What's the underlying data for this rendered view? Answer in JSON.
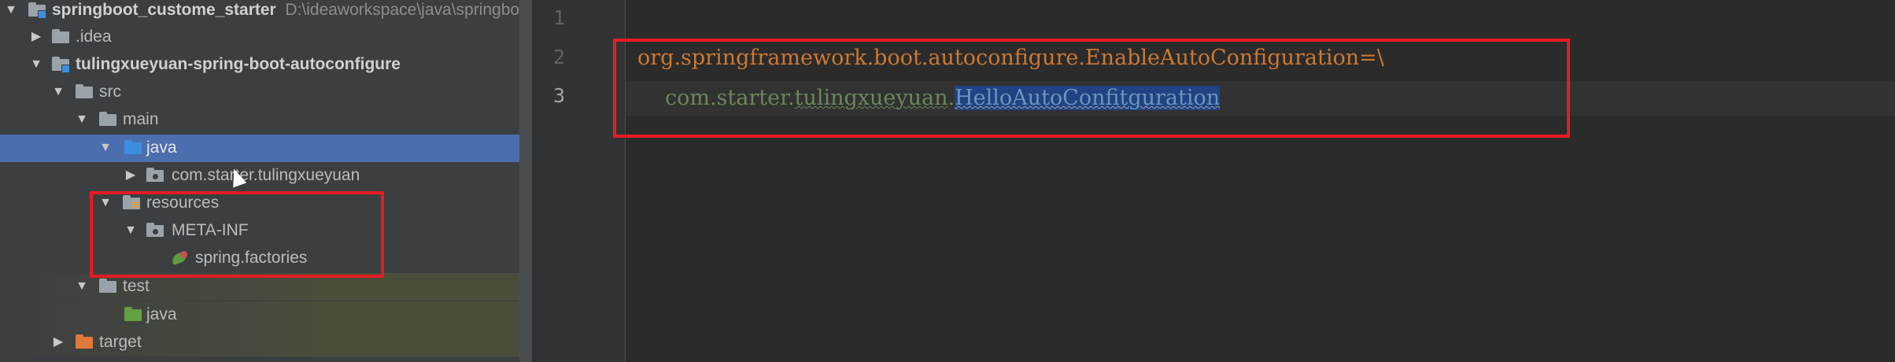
{
  "tree": {
    "rows": [
      {
        "label": "springboot_custome_starter",
        "path": "D:\\ideaworkspace\\java\\springbo"
      },
      {
        "label": ".idea"
      },
      {
        "label": "tulingxueyuan-spring-boot-autoconfigure"
      },
      {
        "label": "src"
      },
      {
        "label": "main"
      },
      {
        "label": "java"
      },
      {
        "label": "com.starter.tulingxueyuan"
      },
      {
        "label": "resources"
      },
      {
        "label": "META-INF"
      },
      {
        "label": "spring.factories"
      },
      {
        "label": "test"
      },
      {
        "label": "java"
      },
      {
        "label": "target"
      }
    ]
  },
  "editor": {
    "line_numbers": [
      "1",
      "2",
      "3"
    ],
    "line2": {
      "package": "org.springframework.boot.autoconfigure.",
      "key": "EnableAutoConfiguration",
      "tail": "=\\"
    },
    "line3": {
      "pkg_a": "com.starter.",
      "pkg_b": "tulingxueyuan",
      "dot": ".",
      "cls": "HelloAutoConfitguration"
    }
  },
  "colors": {
    "selection_row": "#4b6eaf",
    "annotation_box": "#e51c23",
    "keyword": "#cc7832",
    "string": "#6a8759"
  }
}
